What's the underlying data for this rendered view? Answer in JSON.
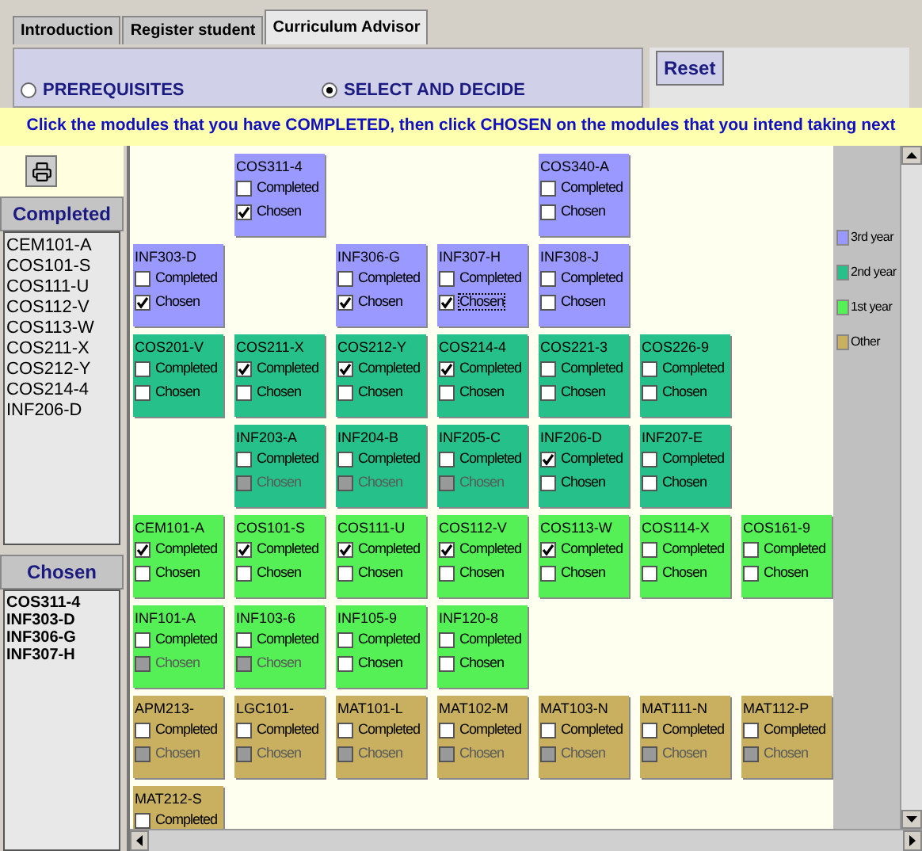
{
  "tabs": [
    {
      "label": "Introduction",
      "selected": false
    },
    {
      "label": "Register student",
      "selected": false
    },
    {
      "label": "Curriculum  Advisor",
      "selected": true
    }
  ],
  "modes": [
    {
      "label": "PREREQUISITES",
      "selected": false
    },
    {
      "label": "SELECT AND DECIDE",
      "selected": true
    }
  ],
  "reset_button": "Reset",
  "instruction": "Click the modules that you have COMPLETED, then click CHOSEN on the modules that you intend taking next",
  "completed_header": "Completed",
  "completed_list": [
    "CEM101-A",
    "COS101-S",
    "COS111-U",
    "COS112-V",
    "COS113-W",
    "COS211-X",
    "COS212-Y",
    "COS214-4",
    "INF206-D"
  ],
  "chosen_header": "Chosen",
  "chosen_list": [
    "COS311-4",
    "INF303-D",
    "INF306-G",
    "INF307-H"
  ],
  "legend": [
    {
      "label": "3rd year",
      "color": "#9999ff"
    },
    {
      "label": "2nd year",
      "color": "#26c08a"
    },
    {
      "label": "1st year",
      "color": "#55f055"
    },
    {
      "label": "Other",
      "color": "#c8b060"
    }
  ],
  "module_rows": [
    [
      {
        "kind": "empty"
      },
      {
        "kind": "module",
        "code": "COS311-4",
        "color": "#9999ff",
        "completed": {
          "label": "Completed",
          "checked": false
        },
        "chosen": {
          "label": "Chosen",
          "checked": true,
          "disabled": false,
          "focused": false
        }
      },
      {
        "kind": "empty"
      },
      {
        "kind": "empty"
      },
      {
        "kind": "module",
        "code": "COS340-A",
        "color": "#9999ff",
        "completed": {
          "label": "Completed",
          "checked": false
        },
        "chosen": {
          "label": "Chosen",
          "checked": false,
          "disabled": false,
          "focused": false
        }
      }
    ],
    [
      {
        "kind": "module",
        "code": "INF303-D",
        "color": "#9999ff",
        "completed": {
          "label": "Completed",
          "checked": false
        },
        "chosen": {
          "label": "Chosen",
          "checked": true,
          "disabled": false,
          "focused": false
        }
      },
      {
        "kind": "empty"
      },
      {
        "kind": "module",
        "code": "INF306-G",
        "color": "#9999ff",
        "completed": {
          "label": "Completed",
          "checked": false
        },
        "chosen": {
          "label": "Chosen",
          "checked": true,
          "disabled": false,
          "focused": false
        }
      },
      {
        "kind": "module",
        "code": "INF307-H",
        "color": "#9999ff",
        "completed": {
          "label": "Completed",
          "checked": false
        },
        "chosen": {
          "label": "Chosen",
          "checked": true,
          "disabled": false,
          "focused": true
        }
      },
      {
        "kind": "module",
        "code": "INF308-J",
        "color": "#9999ff",
        "completed": {
          "label": "Completed",
          "checked": false
        },
        "chosen": {
          "label": "Chosen",
          "checked": false,
          "disabled": false,
          "focused": false
        }
      }
    ],
    [
      {
        "kind": "module",
        "code": "COS201-V",
        "color": "#26c08a",
        "completed": {
          "label": "Completed",
          "checked": false
        },
        "chosen": {
          "label": "Chosen",
          "checked": false,
          "disabled": false,
          "focused": false
        }
      },
      {
        "kind": "module",
        "code": "COS211-X",
        "color": "#26c08a",
        "completed": {
          "label": "Completed",
          "checked": true
        },
        "chosen": {
          "label": "Chosen",
          "checked": false,
          "disabled": false,
          "focused": false
        }
      },
      {
        "kind": "module",
        "code": "COS212-Y",
        "color": "#26c08a",
        "completed": {
          "label": "Completed",
          "checked": true
        },
        "chosen": {
          "label": "Chosen",
          "checked": false,
          "disabled": false,
          "focused": false
        }
      },
      {
        "kind": "module",
        "code": "COS214-4",
        "color": "#26c08a",
        "completed": {
          "label": "Completed",
          "checked": true
        },
        "chosen": {
          "label": "Chosen",
          "checked": false,
          "disabled": false,
          "focused": false
        }
      },
      {
        "kind": "module",
        "code": "COS221-3",
        "color": "#26c08a",
        "completed": {
          "label": "Completed",
          "checked": false
        },
        "chosen": {
          "label": "Chosen",
          "checked": false,
          "disabled": false,
          "focused": false
        }
      },
      {
        "kind": "module",
        "code": "COS226-9",
        "color": "#26c08a",
        "completed": {
          "label": "Completed",
          "checked": false
        },
        "chosen": {
          "label": "Chosen",
          "checked": false,
          "disabled": false,
          "focused": false
        }
      }
    ],
    [
      {
        "kind": "empty"
      },
      {
        "kind": "module",
        "code": "INF203-A",
        "color": "#26c08a",
        "completed": {
          "label": "Completed",
          "checked": false
        },
        "chosen": {
          "label": "Chosen",
          "checked": false,
          "disabled": true,
          "focused": false
        }
      },
      {
        "kind": "module",
        "code": "INF204-B",
        "color": "#26c08a",
        "completed": {
          "label": "Completed",
          "checked": false
        },
        "chosen": {
          "label": "Chosen",
          "checked": false,
          "disabled": true,
          "focused": false
        }
      },
      {
        "kind": "module",
        "code": "INF205-C",
        "color": "#26c08a",
        "completed": {
          "label": "Completed",
          "checked": false
        },
        "chosen": {
          "label": "Chosen",
          "checked": false,
          "disabled": true,
          "focused": false
        }
      },
      {
        "kind": "module",
        "code": "INF206-D",
        "color": "#26c08a",
        "completed": {
          "label": "Completed",
          "checked": true
        },
        "chosen": {
          "label": "Chosen",
          "checked": false,
          "disabled": false,
          "focused": false
        }
      },
      {
        "kind": "module",
        "code": "INF207-E",
        "color": "#26c08a",
        "completed": {
          "label": "Completed",
          "checked": false
        },
        "chosen": {
          "label": "Chosen",
          "checked": false,
          "disabled": false,
          "focused": false
        }
      }
    ],
    [
      {
        "kind": "module",
        "code": "CEM101-A",
        "color": "#55f055",
        "completed": {
          "label": "Completed",
          "checked": true
        },
        "chosen": {
          "label": "Chosen",
          "checked": false,
          "disabled": false,
          "focused": false
        }
      },
      {
        "kind": "module",
        "code": "COS101-S",
        "color": "#55f055",
        "completed": {
          "label": "Completed",
          "checked": true
        },
        "chosen": {
          "label": "Chosen",
          "checked": false,
          "disabled": false,
          "focused": false
        }
      },
      {
        "kind": "module",
        "code": "COS111-U",
        "color": "#55f055",
        "completed": {
          "label": "Completed",
          "checked": true
        },
        "chosen": {
          "label": "Chosen",
          "checked": false,
          "disabled": false,
          "focused": false
        }
      },
      {
        "kind": "module",
        "code": "COS112-V",
        "color": "#55f055",
        "completed": {
          "label": "Completed",
          "checked": true
        },
        "chosen": {
          "label": "Chosen",
          "checked": false,
          "disabled": false,
          "focused": false
        }
      },
      {
        "kind": "module",
        "code": "COS113-W",
        "color": "#55f055",
        "completed": {
          "label": "Completed",
          "checked": true
        },
        "chosen": {
          "label": "Chosen",
          "checked": false,
          "disabled": false,
          "focused": false
        }
      },
      {
        "kind": "module",
        "code": "COS114-X",
        "color": "#55f055",
        "completed": {
          "label": "Completed",
          "checked": false
        },
        "chosen": {
          "label": "Chosen",
          "checked": false,
          "disabled": false,
          "focused": false
        }
      },
      {
        "kind": "module",
        "code": "COS161-9",
        "color": "#55f055",
        "completed": {
          "label": "Completed",
          "checked": false
        },
        "chosen": {
          "label": "Chosen",
          "checked": false,
          "disabled": false,
          "focused": false
        }
      }
    ],
    [
      {
        "kind": "module",
        "code": "INF101-A",
        "color": "#55f055",
        "completed": {
          "label": "Completed",
          "checked": false
        },
        "chosen": {
          "label": "Chosen",
          "checked": false,
          "disabled": true,
          "focused": false
        }
      },
      {
        "kind": "module",
        "code": "INF103-6",
        "color": "#55f055",
        "completed": {
          "label": "Completed",
          "checked": false
        },
        "chosen": {
          "label": "Chosen",
          "checked": false,
          "disabled": true,
          "focused": false
        }
      },
      {
        "kind": "module",
        "code": "INF105-9",
        "color": "#55f055",
        "completed": {
          "label": "Completed",
          "checked": false
        },
        "chosen": {
          "label": "Chosen",
          "checked": false,
          "disabled": false,
          "focused": false
        }
      },
      {
        "kind": "module",
        "code": "INF120-8",
        "color": "#55f055",
        "completed": {
          "label": "Completed",
          "checked": false
        },
        "chosen": {
          "label": "Chosen",
          "checked": false,
          "disabled": false,
          "focused": false
        }
      }
    ],
    [
      {
        "kind": "module",
        "code": "APM213-",
        "color": "#c8b060",
        "completed": {
          "label": "Completed",
          "checked": false
        },
        "chosen": {
          "label": "Chosen",
          "checked": false,
          "disabled": true,
          "focused": false
        }
      },
      {
        "kind": "module",
        "code": "LGC101-",
        "color": "#c8b060",
        "completed": {
          "label": "Completed",
          "checked": false
        },
        "chosen": {
          "label": "Chosen",
          "checked": false,
          "disabled": true,
          "focused": false
        }
      },
      {
        "kind": "module",
        "code": "MAT101-L",
        "color": "#c8b060",
        "completed": {
          "label": "Completed",
          "checked": false
        },
        "chosen": {
          "label": "Chosen",
          "checked": false,
          "disabled": true,
          "focused": false
        }
      },
      {
        "kind": "module",
        "code": "MAT102-M",
        "color": "#c8b060",
        "completed": {
          "label": "Completed",
          "checked": false
        },
        "chosen": {
          "label": "Chosen",
          "checked": false,
          "disabled": true,
          "focused": false
        }
      },
      {
        "kind": "module",
        "code": "MAT103-N",
        "color": "#c8b060",
        "completed": {
          "label": "Completed",
          "checked": false
        },
        "chosen": {
          "label": "Chosen",
          "checked": false,
          "disabled": true,
          "focused": false
        }
      },
      {
        "kind": "module",
        "code": "MAT111-N",
        "color": "#c8b060",
        "completed": {
          "label": "Completed",
          "checked": false
        },
        "chosen": {
          "label": "Chosen",
          "checked": false,
          "disabled": true,
          "focused": false
        }
      },
      {
        "kind": "module",
        "code": "MAT112-P",
        "color": "#c8b060",
        "completed": {
          "label": "Completed",
          "checked": false
        },
        "chosen": {
          "label": "Chosen",
          "checked": false,
          "disabled": true,
          "focused": false
        }
      }
    ],
    [
      {
        "kind": "module",
        "code": "MAT212-S",
        "color": "#c8b060",
        "completed": {
          "label": "Completed",
          "checked": false
        }
      }
    ]
  ]
}
